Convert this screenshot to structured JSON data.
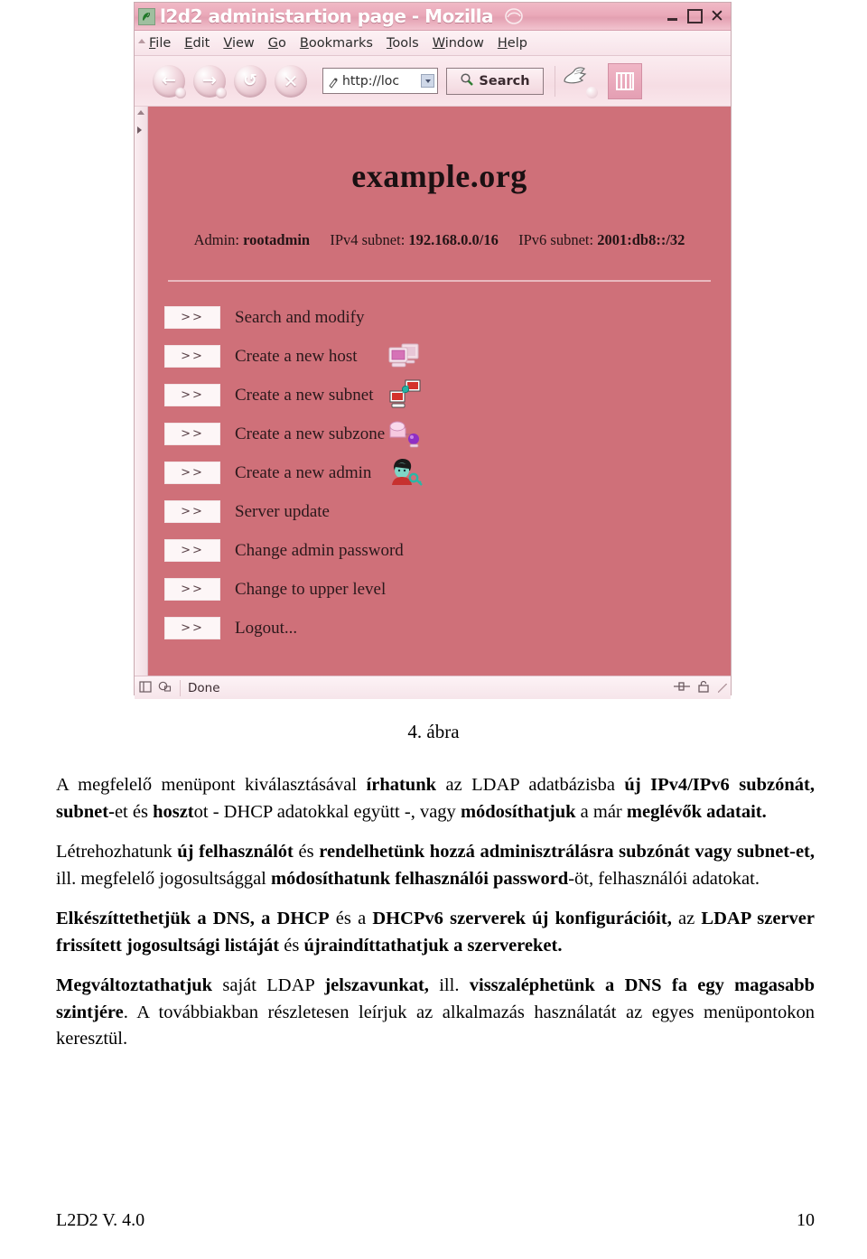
{
  "browser": {
    "title": "l2d2 administartion page - Mozilla",
    "app_icon": "mozilla-lizard-icon",
    "window_controls": {
      "minimize": "–",
      "maximize": "□",
      "close": "×"
    },
    "menubar": [
      {
        "label": "File",
        "accesskey": "F"
      },
      {
        "label": "Edit",
        "accesskey": "E"
      },
      {
        "label": "View",
        "accesskey": "V"
      },
      {
        "label": "Go",
        "accesskey": "G"
      },
      {
        "label": "Bookmarks",
        "accesskey": "B"
      },
      {
        "label": "Tools",
        "accesskey": "T"
      },
      {
        "label": "Window",
        "accesskey": "W"
      },
      {
        "label": "Help",
        "accesskey": "H"
      }
    ],
    "toolbar": {
      "back": "back-icon",
      "forward": "forward-icon",
      "reload": "reload-icon",
      "stop": "stop-icon",
      "url_value": "http://loc",
      "url_placeholder": "http://",
      "search_label": "Search",
      "print": "print-icon",
      "mozilla_logo": "mozilla-logo-icon"
    },
    "statusbar": {
      "text": "Done",
      "left_icons": [
        "sidebar-toggle-icon",
        "cookie-icon"
      ],
      "right_icons": [
        "connection-icon",
        "security-padlock-icon"
      ]
    }
  },
  "page": {
    "title": "example.org",
    "info": {
      "admin_label": "Admin:",
      "admin_value": "rootadmin",
      "ipv4_label": "IPv4 subnet:",
      "ipv4_value": "192.168.0.0/16",
      "ipv6_label": "IPv6 subnet:",
      "ipv6_value": "2001:db8::/32"
    },
    "chevron": ">>",
    "menu_items": [
      {
        "label": "Search and modify",
        "icon": null
      },
      {
        "label": "Create a new host",
        "icon": "computer-host-icon"
      },
      {
        "label": "Create a new subnet",
        "icon": "network-subnet-icon"
      },
      {
        "label": "Create a new subzone",
        "icon": "subzone-icon"
      },
      {
        "label": "Create a new admin",
        "icon": "admin-user-key-icon"
      },
      {
        "label": "Server update",
        "icon": null
      },
      {
        "label": "Change admin password",
        "icon": null
      },
      {
        "label": "Change to upper level",
        "icon": null
      },
      {
        "label": "Logout...",
        "icon": null
      }
    ],
    "background_color": "#cf7079"
  },
  "document": {
    "figure_caption": "4. ábra",
    "paragraphs": [
      [
        {
          "t": "A megfelelő menüpont kiválasztásával ",
          "b": false
        },
        {
          "t": "írhatunk",
          "b": true
        },
        {
          "t": " az LDAP adatbázisba ",
          "b": false
        },
        {
          "t": "új IPv4/IPv6 subzónát, subnet-",
          "b": true
        },
        {
          "t": "et és ",
          "b": false
        },
        {
          "t": "hoszt",
          "b": true
        },
        {
          "t": "ot - DHCP adatokkal együtt -, vagy ",
          "b": false
        },
        {
          "t": "módosíthatjuk",
          "b": true
        },
        {
          "t": " a már ",
          "b": false
        },
        {
          "t": "meglévők adatait.",
          "b": true
        }
      ],
      [
        {
          "t": "Létrehozhatunk ",
          "b": false
        },
        {
          "t": "új felhasználót",
          "b": true
        },
        {
          "t": " és ",
          "b": false
        },
        {
          "t": "rendelhetünk hozzá adminisztrálásra subzónát vagy subnet-et,",
          "b": true
        },
        {
          "t": " ill. megfelelő jogosultsággal ",
          "b": false
        },
        {
          "t": "módosíthatunk felhasználói password",
          "b": true
        },
        {
          "t": "-öt, felhasználói adatokat.",
          "b": false
        }
      ],
      [
        {
          "t": "Elkészíttethetjük a DNS, a DHCP",
          "b": true
        },
        {
          "t": " és a ",
          "b": false
        },
        {
          "t": "DHCPv6 szerverek új konfigurációit,",
          "b": true
        },
        {
          "t": " az ",
          "b": false
        },
        {
          "t": "LDAP szerver frissített jogosultsági listáját",
          "b": true
        },
        {
          "t": " és ",
          "b": false
        },
        {
          "t": "újraindíttathatjuk a szervereket.",
          "b": true
        }
      ],
      [
        {
          "t": "Megváltoztathatjuk",
          "b": true
        },
        {
          "t": " saját LDAP ",
          "b": false
        },
        {
          "t": "jelszavunkat,",
          "b": true
        },
        {
          "t": " ill. ",
          "b": false
        },
        {
          "t": "visszaléphetünk a DNS fa egy magasabb szintjére",
          "b": true
        },
        {
          "t": ".  A továbbiakban részletesen leírjuk az alkalmazás használatát az egyes menüpontokon keresztül.",
          "b": false
        }
      ]
    ],
    "footer_left": "L2D2 V. 4.0",
    "footer_right": "10"
  }
}
